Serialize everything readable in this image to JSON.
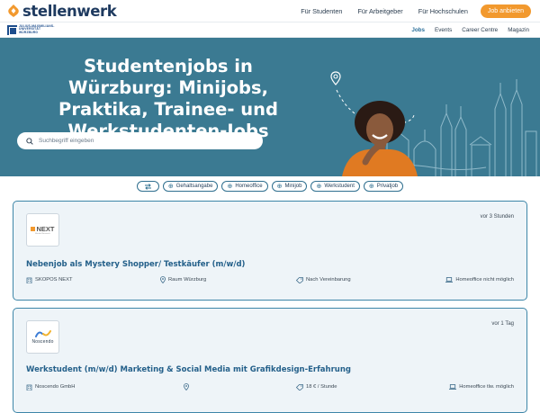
{
  "brand": {
    "name": "stellenwerk"
  },
  "topnav": {
    "items": [
      "Für Studenten",
      "Für Arbeitgeber",
      "Für Hochschulen"
    ],
    "cta": "Job anbieten"
  },
  "uni_logo": {
    "line1": "JULIUS-MAXIMILIANS-",
    "line2": "UNIVERSITÄT",
    "line3": "WÜRZBURG"
  },
  "subnav": {
    "items": [
      "Jobs",
      "Events",
      "Career Centre",
      "Magazin"
    ],
    "active": "Jobs"
  },
  "hero": {
    "title": "Studentenjobs in Würzburg: Minijobs, Praktika, Trainee- und Werkstudenten-Jobs",
    "search_placeholder": "Suchbegriff eingeben"
  },
  "filters": [
    "Gehaltsangabe",
    "Homeoffice",
    "Minijob",
    "Werkstudent",
    "Privatjob"
  ],
  "jobs": [
    {
      "logo_text": "NEXT",
      "logo_sub": "Market Research",
      "posted": "vor 3 Stunden",
      "title": "Nebenjob als Mystery Shopper/ Testkäufer (m/w/d)",
      "company": "SKOPOS NEXT",
      "location": "Raum Würzburg",
      "salary": "Nach Vereinbarung",
      "remote": "Homeoffice nicht möglich"
    },
    {
      "logo_text": "Noscendo",
      "posted": "vor 1 Tag",
      "title": "Werkstudent (m/w/d) Marketing & Social Media mit Grafikdesign-Erfahrung",
      "company": "Noscendo GmbH",
      "location": "",
      "salary": "18 € / Stunde",
      "remote": "Homeoffice tlw. möglich"
    }
  ],
  "colors": {
    "brand": "#1e3a5f",
    "accent": "#f2992e",
    "hero_bg": "#3b7a92",
    "card_border": "#3d86a8",
    "title": "#24608a"
  }
}
